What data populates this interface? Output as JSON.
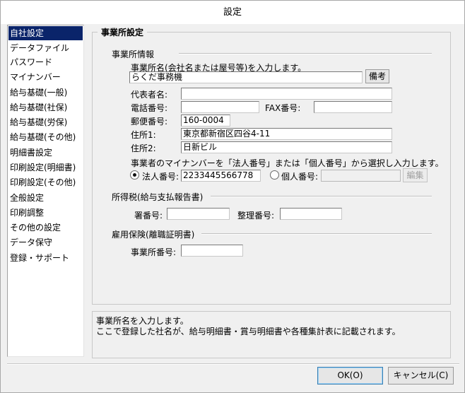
{
  "window": {
    "title": "設定"
  },
  "sidebar": {
    "items": [
      {
        "label": "自社設定",
        "selected": true
      },
      {
        "label": "データファイル"
      },
      {
        "label": "パスワード"
      },
      {
        "label": "マイナンバー"
      },
      {
        "label": "給与基礎(一般)"
      },
      {
        "label": "給与基礎(社保)"
      },
      {
        "label": "給与基礎(労保)"
      },
      {
        "label": "給与基礎(その他)"
      },
      {
        "label": "明細書設定"
      },
      {
        "label": "印刷設定(明細書)"
      },
      {
        "label": "印刷設定(その他)"
      },
      {
        "label": "全般設定"
      },
      {
        "label": "印刷調整"
      },
      {
        "label": "その他の設定"
      },
      {
        "label": "データ保守"
      },
      {
        "label": "登録・サポート"
      }
    ]
  },
  "panel": {
    "title": "事業所設定",
    "office_info": {
      "section_label": "事業所情報",
      "name_prompt": "事業所名(会社名または屋号等)を入力します。",
      "name_value": "らくだ事務機",
      "memo_button": "備考",
      "rep_label": "代表者名:",
      "rep_value": "",
      "phone_label": "電話番号:",
      "phone_value": "",
      "fax_label": "FAX番号:",
      "fax_value": "",
      "zip_label": "郵便番号:",
      "zip_value": "160-0004",
      "addr1_label": "住所1:",
      "addr1_value": "東京都新宿区四谷4-11",
      "addr2_label": "住所2:",
      "addr2_value": "日新ビル",
      "mynumber_prompt": "事業者のマイナンバーを「法人番号」または「個人番号」から選択し入力します。",
      "corp_label": "法人番号:",
      "corp_value": "2233445566778",
      "corp_selected": true,
      "personal_label": "個人番号:",
      "personal_value": "",
      "edit_button": "編集"
    },
    "income_tax": {
      "section_label": "所得税(給与支払報告書)",
      "office_no_label": "署番号:",
      "office_no_value": "",
      "ref_no_label": "整理番号:",
      "ref_no_value": ""
    },
    "employment": {
      "section_label": "雇用保険(離職証明書)",
      "office_no_label": "事業所番号:",
      "office_no_value": ""
    }
  },
  "help": {
    "line1": "事業所名を入力します。",
    "line2": "ここで登録した社名が、給与明細書・賞与明細書や各種集計表に記載されます。"
  },
  "buttons": {
    "ok": "OK(O)",
    "cancel": "キャンセル(C)"
  }
}
